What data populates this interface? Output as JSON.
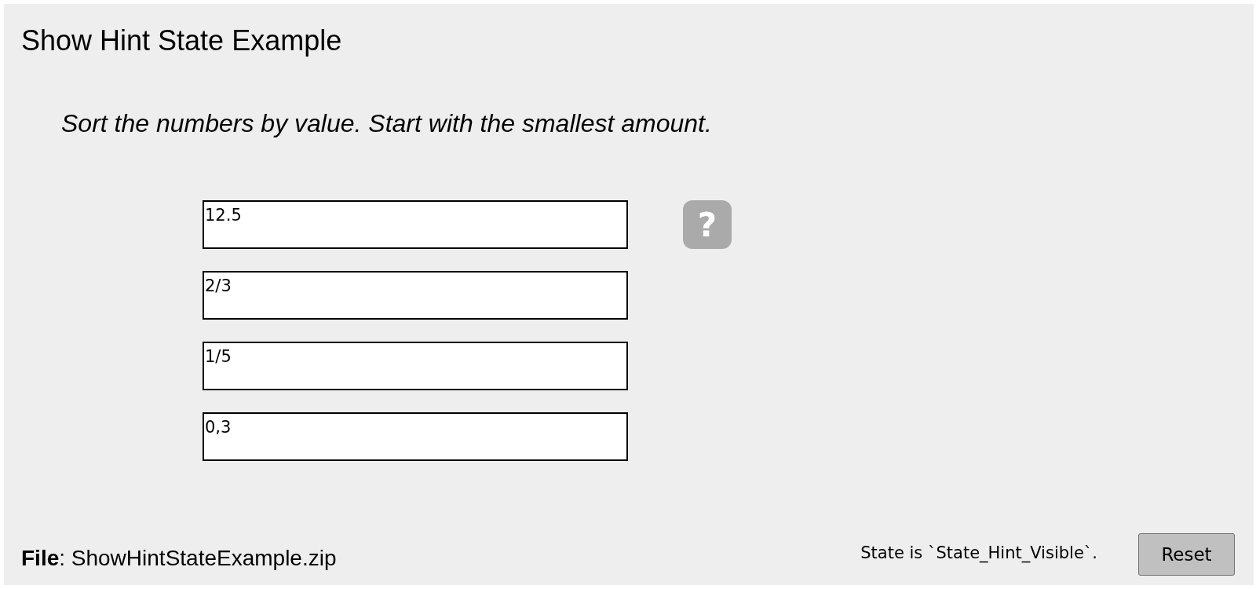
{
  "title": "Show Hint State Example",
  "instruction": "Sort the numbers by value. Start with the smallest amount.",
  "fields": [
    {
      "value": "12.5"
    },
    {
      "value": "2/3"
    },
    {
      "value": "1/5"
    },
    {
      "value": "0,3"
    }
  ],
  "hint_button": {
    "label": "?"
  },
  "file_info": "**File**: ShowHintStateExample.zip",
  "state_text": "State is `State_Hint_Visible`.",
  "reset_button": {
    "label": "Reset"
  }
}
